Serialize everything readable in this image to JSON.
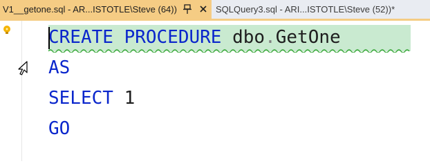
{
  "tabs": [
    {
      "label": "V1__getone.sql - AR...ISTOTLE\\Steve (64))",
      "active": true
    },
    {
      "label": "SQLQuery3.sql - ARI...ISTOTLE\\Steve (52))*",
      "active": false
    }
  ],
  "editor": {
    "lines": [
      {
        "keyword1": "CREATE",
        "keyword2": "PROCEDURE",
        "schema": "dbo",
        "dot": ".",
        "name": "GetOne"
      },
      {
        "keyword": "AS"
      },
      {
        "keyword": "SELECT",
        "value": "1"
      },
      {
        "keyword": "GO"
      }
    ]
  },
  "icons": {
    "pin": "pin-icon",
    "close": "close-icon",
    "lightbulb": "lightbulb-icon",
    "cursor": "reverse-arrow-cursor-icon"
  },
  "colors": {
    "active_tab": "#f5cc84",
    "keyword": "#0a26cc",
    "line_highlight": "#c9ead0",
    "squiggle": "#3aa83a"
  }
}
